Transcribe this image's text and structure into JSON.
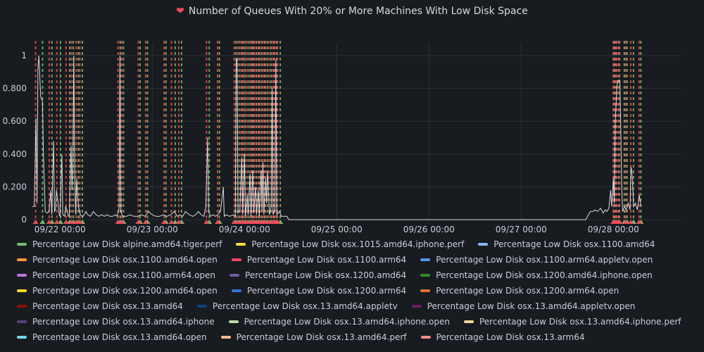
{
  "panel": {
    "title": "Number of Queues With 20% or More Machines With Low Disk Space",
    "title_icon": "broken-heart-icon",
    "title_icon_color": "#f2495c"
  },
  "chart_data": {
    "type": "line",
    "title": "Number of Queues With 20% or More Machines With Low Disk Space",
    "xlabel": "",
    "ylabel": "",
    "x_ticks": [
      "09/22 00:00",
      "09/23 00:00",
      "09/24 00:00",
      "09/25 00:00",
      "09/26 00:00",
      "09/27 00:00",
      "09/28 00:00"
    ],
    "y_ticks": [
      "0",
      "0.200",
      "0.400",
      "0.600",
      "0.800",
      "1"
    ],
    "ylim": [
      0,
      1.05
    ],
    "xlim_days": [
      21.7,
      28.45
    ],
    "grid": true,
    "legend_position": "bottom",
    "series_color": "#d8d9da",
    "series": [
      {
        "points": [
          [
            21.7,
            0.08
          ],
          [
            21.72,
            0.08
          ],
          [
            21.74,
            0.62
          ],
          [
            21.75,
            0.1
          ],
          [
            21.76,
            0.92
          ],
          [
            21.77,
            1.0
          ],
          [
            21.79,
            0.75
          ],
          [
            21.81,
            0.72
          ],
          [
            21.82,
            0.4
          ],
          [
            21.84,
            0.05
          ],
          [
            21.86,
            0.04
          ],
          [
            21.88,
            0.05
          ],
          [
            21.9,
            0.18
          ],
          [
            21.91,
            0.03
          ],
          [
            21.93,
            0.48
          ],
          [
            21.94,
            0.05
          ],
          [
            21.95,
            0.06
          ],
          [
            21.96,
            0.18
          ],
          [
            21.98,
            0.1
          ],
          [
            21.99,
            0.03
          ],
          [
            22.0,
            0.02
          ],
          [
            22.02,
            0.4
          ],
          [
            22.03,
            0.03
          ],
          [
            22.05,
            0.02
          ],
          [
            22.06,
            0.08
          ],
          [
            22.08,
            0.05
          ],
          [
            22.09,
            0.02
          ],
          [
            22.1,
            0.02
          ],
          [
            22.12,
            0.45
          ],
          [
            22.13,
            0.18
          ],
          [
            22.14,
            0.38
          ],
          [
            22.15,
            1.0
          ],
          [
            22.16,
            0.25
          ],
          [
            22.17,
            0.03
          ],
          [
            22.18,
            0.25
          ],
          [
            22.19,
            0.15
          ],
          [
            22.2,
            0.08
          ],
          [
            22.22,
            0.03
          ],
          [
            22.25,
            0.02
          ],
          [
            22.28,
            0.05
          ],
          [
            22.3,
            0.03
          ],
          [
            22.33,
            0.02
          ],
          [
            22.36,
            0.05
          ],
          [
            22.39,
            0.03
          ],
          [
            22.42,
            0.02
          ],
          [
            22.45,
            0.03
          ],
          [
            22.48,
            0.02
          ],
          [
            22.51,
            0.03
          ],
          [
            22.54,
            0.02
          ],
          [
            22.57,
            0.02
          ],
          [
            22.6,
            0.03
          ],
          [
            22.62,
            0.02
          ],
          [
            22.64,
            0.07
          ],
          [
            22.65,
            1.0
          ],
          [
            22.66,
            0.05
          ],
          [
            22.68,
            0.02
          ],
          [
            22.72,
            0.02
          ],
          [
            22.76,
            0.03
          ],
          [
            22.8,
            0.02
          ],
          [
            22.84,
            0.02
          ],
          [
            22.88,
            0.03
          ],
          [
            22.92,
            0.02
          ],
          [
            22.96,
            0.05
          ],
          [
            23.0,
            0.03
          ],
          [
            23.04,
            0.02
          ],
          [
            23.08,
            0.02
          ],
          [
            23.12,
            0.03
          ],
          [
            23.16,
            0.02
          ],
          [
            23.2,
            0.03
          ],
          [
            23.24,
            0.05
          ],
          [
            23.27,
            0.02
          ],
          [
            23.3,
            0.03
          ],
          [
            23.33,
            0.02
          ],
          [
            23.36,
            0.05
          ],
          [
            23.4,
            0.03
          ],
          [
            23.44,
            0.02
          ],
          [
            23.47,
            0.03
          ],
          [
            23.5,
            0.05
          ],
          [
            23.53,
            0.03
          ],
          [
            23.56,
            0.02
          ],
          [
            23.58,
            0.08
          ],
          [
            23.6,
            0.5
          ],
          [
            23.61,
            0.05
          ],
          [
            23.63,
            0.02
          ],
          [
            23.66,
            0.03
          ],
          [
            23.68,
            0.02
          ],
          [
            23.71,
            0.03
          ],
          [
            23.74,
            0.05
          ],
          [
            23.77,
            0.2
          ],
          [
            23.78,
            0.02
          ],
          [
            23.8,
            0.03
          ],
          [
            23.84,
            0.02
          ],
          [
            23.88,
            0.03
          ],
          [
            23.9,
            0.02
          ],
          [
            23.91,
            0.97
          ],
          [
            23.92,
            0.98
          ],
          [
            23.93,
            0.04
          ],
          [
            23.95,
            0.06
          ],
          [
            23.97,
            0.38
          ],
          [
            23.98,
            0.03
          ],
          [
            24.0,
            0.4
          ],
          [
            24.01,
            0.02
          ],
          [
            24.03,
            0.15
          ],
          [
            24.04,
            0.03
          ],
          [
            24.06,
            0.28
          ],
          [
            24.07,
            0.02
          ],
          [
            24.09,
            0.3
          ],
          [
            24.1,
            0.04
          ],
          [
            24.12,
            0.2
          ],
          [
            24.13,
            0.03
          ],
          [
            24.15,
            0.18
          ],
          [
            24.16,
            0.02
          ],
          [
            24.18,
            0.3
          ],
          [
            24.19,
            0.05
          ],
          [
            24.2,
            0.35
          ],
          [
            24.21,
            0.03
          ],
          [
            24.23,
            0.25
          ],
          [
            24.24,
            0.1
          ],
          [
            24.25,
            0.3
          ],
          [
            24.27,
            0.03
          ],
          [
            24.29,
            0.08
          ],
          [
            24.3,
            0.8
          ],
          [
            24.31,
            0.03
          ],
          [
            24.33,
            0.06
          ],
          [
            24.34,
            0.97
          ],
          [
            24.35,
            0.03
          ],
          [
            24.38,
            0.05
          ],
          [
            24.4,
            0.02
          ],
          [
            24.43,
            0.02
          ],
          [
            24.46,
            0.02
          ],
          [
            24.47,
            0.01
          ],
          [
            24.48,
            0.0
          ],
          [
            24.52,
            0.0
          ],
          [
            25.0,
            0.0
          ],
          [
            25.5,
            0.0
          ],
          [
            26.0,
            0.0
          ],
          [
            26.5,
            0.0
          ],
          [
            27.0,
            0.0
          ],
          [
            27.5,
            0.0
          ],
          [
            27.7,
            0.0
          ],
          [
            27.72,
            0.02
          ],
          [
            27.75,
            0.05
          ],
          [
            27.78,
            0.05
          ],
          [
            27.8,
            0.06
          ],
          [
            27.83,
            0.05
          ],
          [
            27.86,
            0.07
          ],
          [
            27.89,
            0.04
          ],
          [
            27.91,
            0.06
          ],
          [
            27.93,
            0.05
          ],
          [
            27.95,
            0.07
          ],
          [
            27.97,
            0.18
          ],
          [
            27.98,
            0.08
          ],
          [
            28.0,
            0.25
          ],
          [
            28.01,
            0.1
          ],
          [
            28.02,
            0.6
          ],
          [
            28.04,
            0.82
          ],
          [
            28.05,
            0.85
          ],
          [
            28.07,
            0.85
          ],
          [
            28.08,
            0.55
          ],
          [
            28.09,
            0.2
          ],
          [
            28.1,
            0.05
          ],
          [
            28.12,
            0.08
          ],
          [
            28.14,
            0.06
          ],
          [
            28.16,
            0.1
          ],
          [
            28.18,
            0.06
          ],
          [
            28.19,
            0.32
          ],
          [
            28.2,
            0.3
          ],
          [
            28.22,
            0.08
          ],
          [
            28.24,
            0.1
          ],
          [
            28.26,
            0.06
          ],
          [
            28.28,
            0.15
          ],
          [
            28.3,
            0.08
          ]
        ]
      }
    ],
    "annotations": {
      "color_red": "#f2495c",
      "color_green": "#73bf69",
      "red_days": [
        21.735,
        21.882,
        21.965,
        22.065,
        22.125,
        22.175,
        22.215,
        22.628,
        22.668,
        22.848,
        22.928,
        23.128,
        23.208,
        23.288,
        23.588,
        23.708,
        23.888,
        23.928,
        23.968,
        23.988,
        24.028,
        24.068,
        24.088,
        24.108,
        24.148,
        24.168,
        24.208,
        24.228,
        24.268,
        24.308,
        24.328,
        24.358,
        27.998,
        28.018,
        28.038,
        28.068,
        28.133,
        28.188,
        28.278
      ],
      "green_days": [
        21.81,
        21.912,
        22.005,
        22.105,
        22.145,
        22.198,
        22.242,
        22.652,
        22.688,
        22.868,
        22.948,
        23.148,
        23.248,
        23.318,
        23.618,
        23.728,
        23.908,
        23.948,
        23.978,
        24.008,
        24.048,
        24.078,
        24.098,
        24.128,
        24.158,
        24.188,
        24.218,
        24.248,
        24.288,
        24.318,
        24.348,
        24.388,
        28.008,
        28.028,
        28.058,
        28.118,
        28.148,
        28.218,
        28.298
      ]
    },
    "legend": [
      {
        "label": "Percentage Low Disk alpine.amd64.tiger.perf",
        "color": "#73bf69"
      },
      {
        "label": "Percentage Low Disk osx.1015.amd64.iphone.perf",
        "color": "#fade2a"
      },
      {
        "label": "Percentage Low Disk osx.1100.amd64",
        "color": "#8ab8ff"
      },
      {
        "label": "Percentage Low Disk osx.1100.amd64.open",
        "color": "#ff9830"
      },
      {
        "label": "Percentage Low Disk osx.1100.arm64",
        "color": "#f2495c"
      },
      {
        "label": "Percentage Low Disk osx.1100.arm64.appletv.open",
        "color": "#5794f2"
      },
      {
        "label": "Percentage Low Disk osx.1100.arm64.open",
        "color": "#b877d9"
      },
      {
        "label": "Percentage Low Disk osx.1200.amd64",
        "color": "#705da0"
      },
      {
        "label": "Percentage Low Disk osx.1200.amd64.iphone.open",
        "color": "#37872d"
      },
      {
        "label": "Percentage Low Disk osx.1200.amd64.open",
        "color": "#fade2a"
      },
      {
        "label": "Percentage Low Disk osx.1200.arm64",
        "color": "#3274d9"
      },
      {
        "label": "Percentage Low Disk osx.1200.arm64.open",
        "color": "#e0752d"
      },
      {
        "label": "Percentage Low Disk osx.13.amd64",
        "color": "#890f02"
      },
      {
        "label": "Percentage Low Disk osx.13.amd64.appletv",
        "color": "#0a437c"
      },
      {
        "label": "Percentage Low Disk osx.13.amd64.appletv.open",
        "color": "#6d1f62"
      },
      {
        "label": "Percentage Low Disk osx.13.amd64.iphone",
        "color": "#584477"
      },
      {
        "label": "Percentage Low Disk osx.13.amd64.iphone.open",
        "color": "#b7dbab"
      },
      {
        "label": "Percentage Low Disk osx.13.amd64.iphone.perf",
        "color": "#f4d598"
      },
      {
        "label": "Percentage Low Disk osx.13.amd64.open",
        "color": "#70dbed"
      },
      {
        "label": "Percentage Low Disk osx.13.amd64.perf",
        "color": "#f9ba8f"
      },
      {
        "label": "Percentage Low Disk osx.13.arm64",
        "color": "#f29191"
      }
    ]
  }
}
